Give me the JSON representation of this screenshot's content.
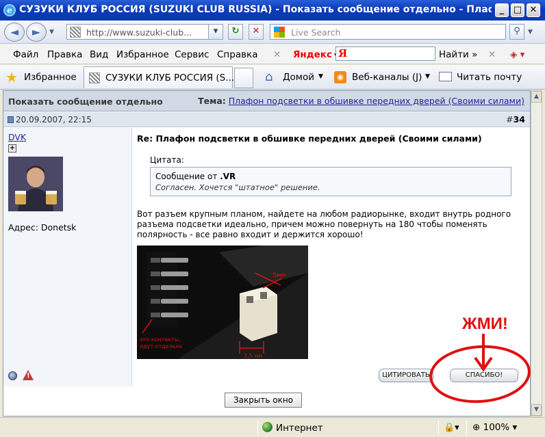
{
  "window": {
    "title": "СУЗУКИ КЛУБ РОССИЯ (SUZUKI CLUB RUSSIA) - Показать сообщение отдельно - Плафон под...",
    "logo_letter": "e",
    "minimize": "_",
    "maximize": "□",
    "close": "✕"
  },
  "nav": {
    "back": "◄",
    "forward": "►",
    "url": "http://www.suzuki-club...",
    "refresh": "↻",
    "stop": "✕",
    "search_placeholder": "Live Search",
    "search_button": "⚲"
  },
  "menu": {
    "items": [
      "Файл",
      "Правка",
      "Вид",
      "Избранное",
      "Сервис",
      "Справка"
    ],
    "yandex_label": "Яндекс",
    "yandex_logo": "Я",
    "find_label": "Найти"
  },
  "favbar": {
    "favorites_label": "Избранное",
    "tab_title": "СУЗУКИ КЛУБ РОССИЯ (S...",
    "home_label": "Домой",
    "feeds_label": "Веб-каналы (J)",
    "mail_label": "Читать почту"
  },
  "page": {
    "header_left": "Показать сообщение отдельно",
    "topic_label": "Тема:",
    "topic_link": "Плафон подсветки в обшивке передних дверей (Своими силами)",
    "post_date": "20.09.2007, 22:15",
    "post_number_prefix": "#",
    "post_number": "34",
    "username": "DVK",
    "plus": "+",
    "address": "Адрес: Donetsk",
    "post_title": "Re: Плафон подсветки в обшивке передних дверей (Своими силами)",
    "quote_label": "Цитата:",
    "quote_from_prefix": "Сообщение от",
    "quote_author": ".VR",
    "quote_text": "Согласен. Хочется \"штатное\" решение.",
    "post_text": "Вот разъем крупным планом, найдете на любом радиорынке, входит внутрь родного разъема подсветки идеально, причем можно повернуть на 180 чтобы поменять полярность - все равно входит и держится хорошо!",
    "photo_notes": {
      "contacts": [
        "это-контакты,",
        "идут отдельно"
      ],
      "dim_5": "5мм",
      "dim_2": "2,5 мм"
    },
    "quote_button": "ЦИТИРОВАТЬ",
    "thanks_button": "СПАСИБО!",
    "close_button": "Закрыть окно",
    "annotation": "ЖМИ!"
  },
  "status": {
    "zone": "Интернет",
    "zoom": "100%"
  },
  "colors": {
    "title_bar": "#0a3bb8",
    "annotation": "#e01010",
    "link": "#22229c"
  }
}
